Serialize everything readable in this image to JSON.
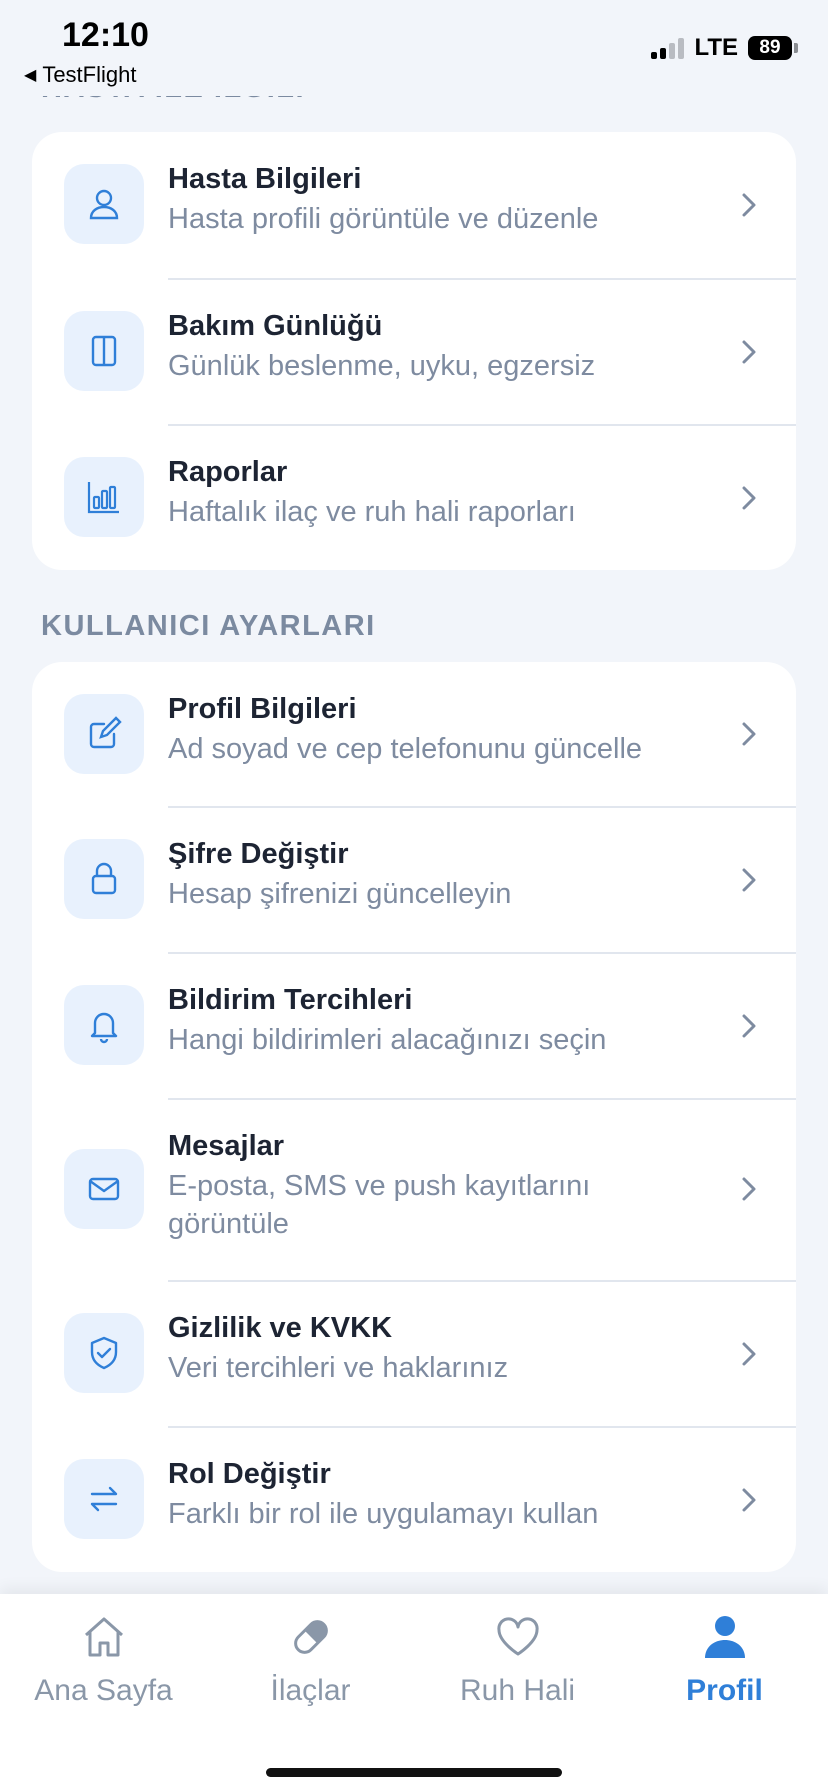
{
  "status_bar": {
    "time": "12:10",
    "back_label": "TestFlight",
    "network": "LTE",
    "battery": "89"
  },
  "sections": [
    {
      "title": "HASTA İLE İLGİLİ",
      "items": [
        {
          "icon": "person-icon",
          "title": "Hasta Bilgileri",
          "subtitle": "Hasta profili görüntüle ve düzenle"
        },
        {
          "icon": "journal-icon",
          "title": "Bakım Günlüğü",
          "subtitle": "Günlük beslenme, uyku, egzersiz"
        },
        {
          "icon": "bar-chart-icon",
          "title": "Raporlar",
          "subtitle": "Haftalık ilaç ve ruh hali raporları"
        }
      ]
    },
    {
      "title": "KULLANICI AYARLARI",
      "items": [
        {
          "icon": "edit-icon",
          "title": "Profil Bilgileri",
          "subtitle": "Ad soyad ve cep telefonunu güncelle"
        },
        {
          "icon": "lock-icon",
          "title": "Şifre Değiştir",
          "subtitle": "Hesap şifrenizi güncelleyin"
        },
        {
          "icon": "bell-icon",
          "title": "Bildirim Tercihleri",
          "subtitle": "Hangi bildirimleri alacağınızı seçin"
        },
        {
          "icon": "mail-icon",
          "title": "Mesajlar",
          "subtitle": "E-posta, SMS ve push kayıtlarını görüntüle"
        },
        {
          "icon": "shield-check-icon",
          "title": "Gizlilik ve KVKK",
          "subtitle": "Veri tercihleri ve haklarınız"
        },
        {
          "icon": "swap-icon",
          "title": "Rol Değiştir",
          "subtitle": "Farklı bir rol ile uygulamayı kullan"
        }
      ]
    }
  ],
  "tab_bar": {
    "tabs": [
      {
        "icon": "home-icon",
        "label": "Ana Sayfa",
        "active": false
      },
      {
        "icon": "pill-icon",
        "label": "İlaçlar",
        "active": false
      },
      {
        "icon": "heart-icon",
        "label": "Ruh Hali",
        "active": false
      },
      {
        "icon": "profile-icon",
        "label": "Profil",
        "active": true
      }
    ]
  },
  "colors": {
    "accent": "#2f7fd8",
    "icon_bg": "#e8f1fd",
    "background": "#f2f5fa",
    "muted_text": "#7e8ba0"
  }
}
